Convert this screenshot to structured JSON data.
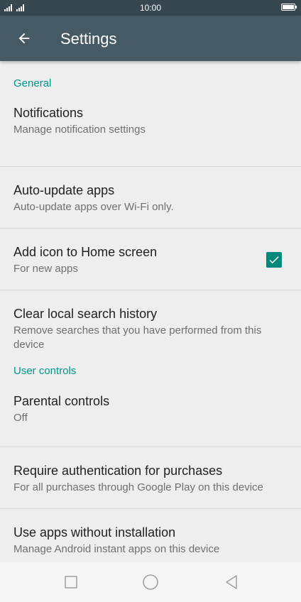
{
  "status_bar": {
    "time": "10:00"
  },
  "app_bar": {
    "title": "Settings",
    "back_icon": "arrow-back-icon"
  },
  "sections": [
    {
      "header": "General",
      "items": [
        {
          "title": "Notifications",
          "summary": "Manage notification settings"
        },
        {
          "title": "Auto-update apps",
          "summary": "Auto-update apps over Wi-Fi only."
        },
        {
          "title": "Add icon to Home screen",
          "summary": "For new apps",
          "checked": true
        },
        {
          "title": "Clear local search history",
          "summary": "Remove searches that you have performed from this device"
        }
      ]
    },
    {
      "header": "User controls",
      "items": [
        {
          "title": "Parental controls",
          "summary": "Off"
        },
        {
          "title": "Require authentication for purchases",
          "summary": "For all purchases through Google Play on this device"
        },
        {
          "title": "Use apps without installation",
          "summary": "Manage Android instant apps on this device"
        }
      ]
    }
  ],
  "nav_bar": {
    "buttons": [
      "recent-apps-icon",
      "home-icon",
      "back-icon"
    ]
  },
  "colors": {
    "status_bar": "#37474f",
    "app_bar": "#455a64",
    "accent": "#009688",
    "background": "#eeeeee"
  }
}
